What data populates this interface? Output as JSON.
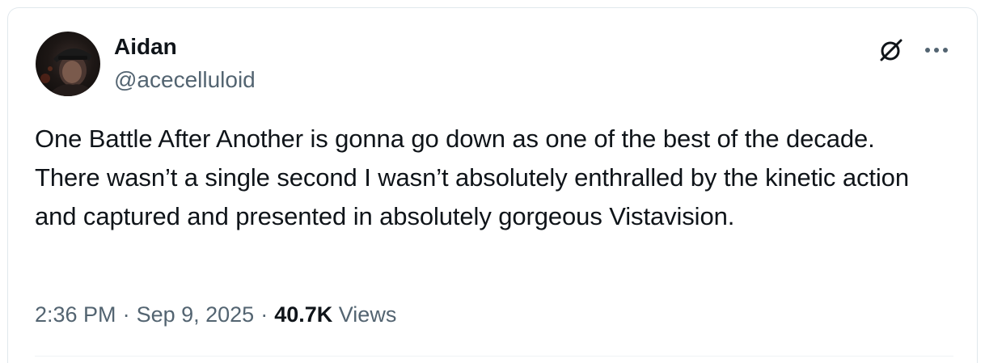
{
  "author": {
    "display_name": "Aidan",
    "handle": "@acecelluloid"
  },
  "tweet": {
    "text": "One Battle After Another is gonna go down as one of the best of the decade. There wasn’t a single second I wasn’t absolutely enthralled by the kinetic action and captured and presented in absolutely gorgeous Vistavision."
  },
  "meta": {
    "time": "2:36 PM",
    "separator": "·",
    "date": "Sep 9, 2025",
    "views_count": "40.7K",
    "views_label": "Views"
  },
  "icons": {
    "grok": "grok-icon",
    "more": "more-dots-icon"
  },
  "colors": {
    "text_primary": "#0f1419",
    "text_secondary": "#536471",
    "border": "#e1e8ed"
  }
}
